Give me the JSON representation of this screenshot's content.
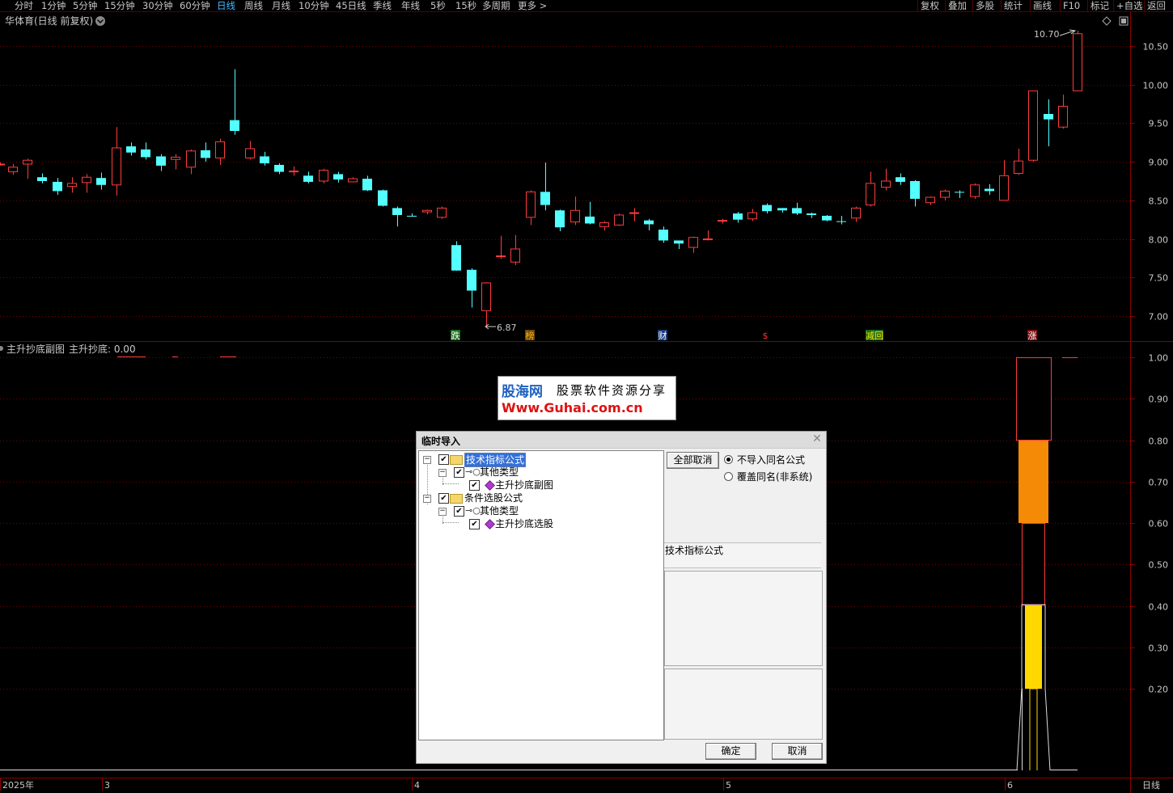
{
  "toolbar": {
    "periods": [
      "分时",
      "1分钟",
      "5分钟",
      "15分钟",
      "30分钟",
      "60分钟",
      "日线",
      "周线",
      "月线",
      "10分钟",
      "45日线",
      "季线",
      "年线",
      "5秒",
      "15秒",
      "多周期",
      "更多 >"
    ],
    "active_period": "日线",
    "right_buttons": [
      "复权",
      "叠加",
      "多股",
      "统计",
      "画线",
      "F10",
      "标记",
      "+自选",
      "返回"
    ]
  },
  "main_chart": {
    "title": "华体育(日线 前复权)",
    "price_axis": [
      "10.50",
      "10.00",
      "9.50",
      "9.00",
      "8.50",
      "8.00",
      "7.50",
      "7.00"
    ],
    "high_marker": "10.70",
    "low_marker": "6.87",
    "event_markers": [
      "跌",
      "榜",
      "财",
      "$",
      "减回",
      "涨"
    ]
  },
  "sub_chart": {
    "title": "主升抄底副图",
    "value_label": "主升抄底: 0.00",
    "axis": [
      "1.00",
      "0.90",
      "0.80",
      "0.70",
      "0.60",
      "0.50",
      "0.40",
      "0.30",
      "0.20"
    ]
  },
  "time_axis": {
    "labels": [
      "2025年",
      "3",
      "4",
      "5",
      "6"
    ],
    "period_label": "日线"
  },
  "watermark": {
    "name": "股海网",
    "slogan": "股票软件资源分享",
    "url": "Www.Guhai.com.cn"
  },
  "dialog": {
    "title": "临时导入",
    "tree": [
      {
        "label": "技术指标公式",
        "level": 0,
        "icon": "folder",
        "selected": true
      },
      {
        "label": "其他类型",
        "level": 1,
        "icon": "key"
      },
      {
        "label": "主升抄底副图",
        "level": 2,
        "icon": "diamond"
      },
      {
        "label": "条件选股公式",
        "level": 0,
        "icon": "folder"
      },
      {
        "label": "其他类型",
        "level": 1,
        "icon": "key"
      },
      {
        "label": "主升抄底选股",
        "level": 2,
        "icon": "diamond"
      }
    ],
    "cancel_all_label": "全部取消",
    "option_no_import": "不导入同名公式",
    "option_overwrite": "覆盖同名(非系统)",
    "info_title": "技术指标公式",
    "ok_label": "确定",
    "cancel_label": "取消"
  },
  "colors": {
    "up": "#ff3c3c",
    "down": "#54ffff",
    "grid": "#7a0000",
    "orange": "#f58a07",
    "yellow": "#ffd800"
  }
}
